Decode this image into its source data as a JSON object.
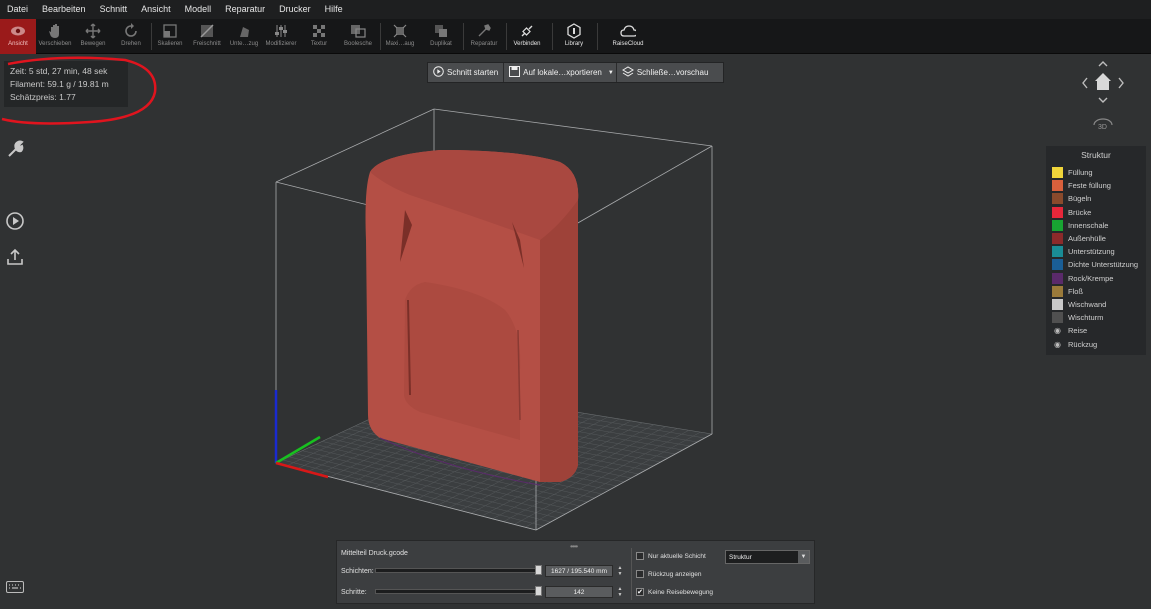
{
  "menu": [
    "Datei",
    "Bearbeiten",
    "Schnitt",
    "Ansicht",
    "Modell",
    "Reparatur",
    "Drucker",
    "Hilfe"
  ],
  "toolbar": {
    "ansicht": "Ansicht",
    "verschieben": "Verschieben",
    "bewegen": "Bewegen",
    "drehen": "Drehen",
    "skalieren": "Skalieren",
    "freischnitt": "Freischnitt",
    "unterzug": "Unte…zug",
    "modifizierer": "Modifizierer",
    "textur": "Textur",
    "boolesche": "Boolesche",
    "maxiaug": "Maxi…aug",
    "duplikat": "Duplikat",
    "reparatur": "Reparatur",
    "verbinden": "Verbinden",
    "library": "Library",
    "raisecloud": "RaiseCloud"
  },
  "info": {
    "time": "Zeit: 5 std, 27 min, 48 sek",
    "filament": "Filament: 59.1 g / 19.81 m",
    "price": "Schätzpreis: 1.77"
  },
  "actions": {
    "slice": "Schnitt starten",
    "export": "Auf lokale…xportieren",
    "close_preview": "Schließe…vorschau"
  },
  "legend": {
    "title": "Struktur",
    "items": [
      {
        "label": "Füllung",
        "color": "#f0d53a"
      },
      {
        "label": "Feste füllung",
        "color": "#d9603c"
      },
      {
        "label": "Bügeln",
        "color": "#8a4a2c"
      },
      {
        "label": "Brücke",
        "color": "#e8273a"
      },
      {
        "label": "Innenschale",
        "color": "#18a432"
      },
      {
        "label": "Außenhülle",
        "color": "#8c2a2a"
      },
      {
        "label": "Unterstützung",
        "color": "#1a8c96"
      },
      {
        "label": "Dichte Unterstützung",
        "color": "#1a5e96"
      },
      {
        "label": "Rock/Krempe",
        "color": "#5a2a6a"
      },
      {
        "label": "Floß",
        "color": "#9a7a3a"
      },
      {
        "label": "Wischwand",
        "color": "#c8c8c8"
      },
      {
        "label": "Wischturm",
        "color": "#505050"
      }
    ],
    "toggles": [
      {
        "label": "Reise",
        "icon": "eye-icon"
      },
      {
        "label": "Rückzug",
        "icon": "eye-icon"
      }
    ]
  },
  "panel": {
    "grip": "••••",
    "filename": "Mittelteil Druck.gcode",
    "layers_label": "Schichten:",
    "layers_value": "1627 / 195.540 mm",
    "layers_fraction": 1.0,
    "steps_label": "Schritte:",
    "steps_value": "142",
    "steps_fraction": 1.0,
    "only_current_layer": "Nur aktuelle Schicht",
    "show_retraction": "Rückzug anzeigen",
    "no_travel": "Keine Reisebewegung",
    "only_current_checked": false,
    "show_retraction_checked": false,
    "no_travel_checked": true,
    "view_mode": "Struktur"
  },
  "colors": {
    "model": "#b44f45",
    "accent_active": "#9a1a1a",
    "annotation": "#e0141e"
  }
}
